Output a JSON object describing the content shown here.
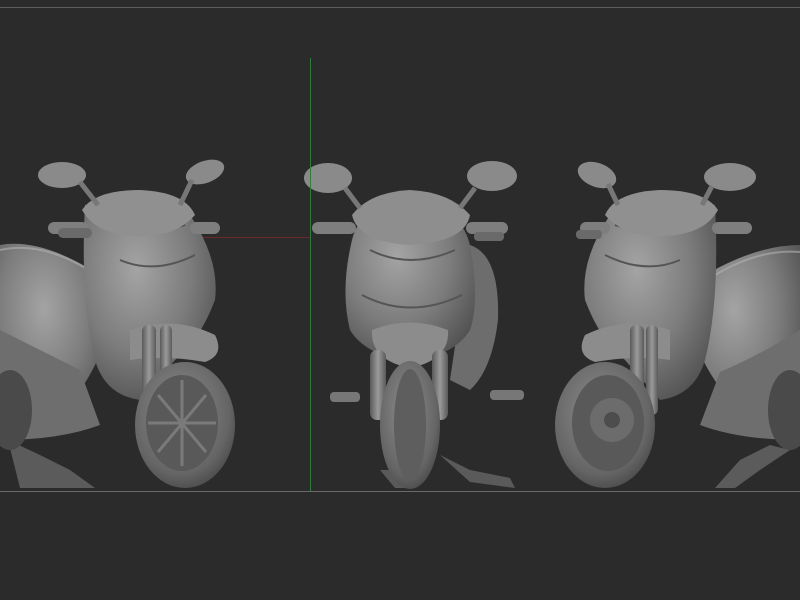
{
  "viewport": {
    "background": "#2b2b2b",
    "axis_colors": {
      "y_axis": "#2e7d3a",
      "x_axis": "#6b2a2a"
    },
    "model_color": "#8a8a8a",
    "views": [
      {
        "name": "left-three-quarter"
      },
      {
        "name": "front"
      },
      {
        "name": "right-three-quarter"
      }
    ]
  }
}
